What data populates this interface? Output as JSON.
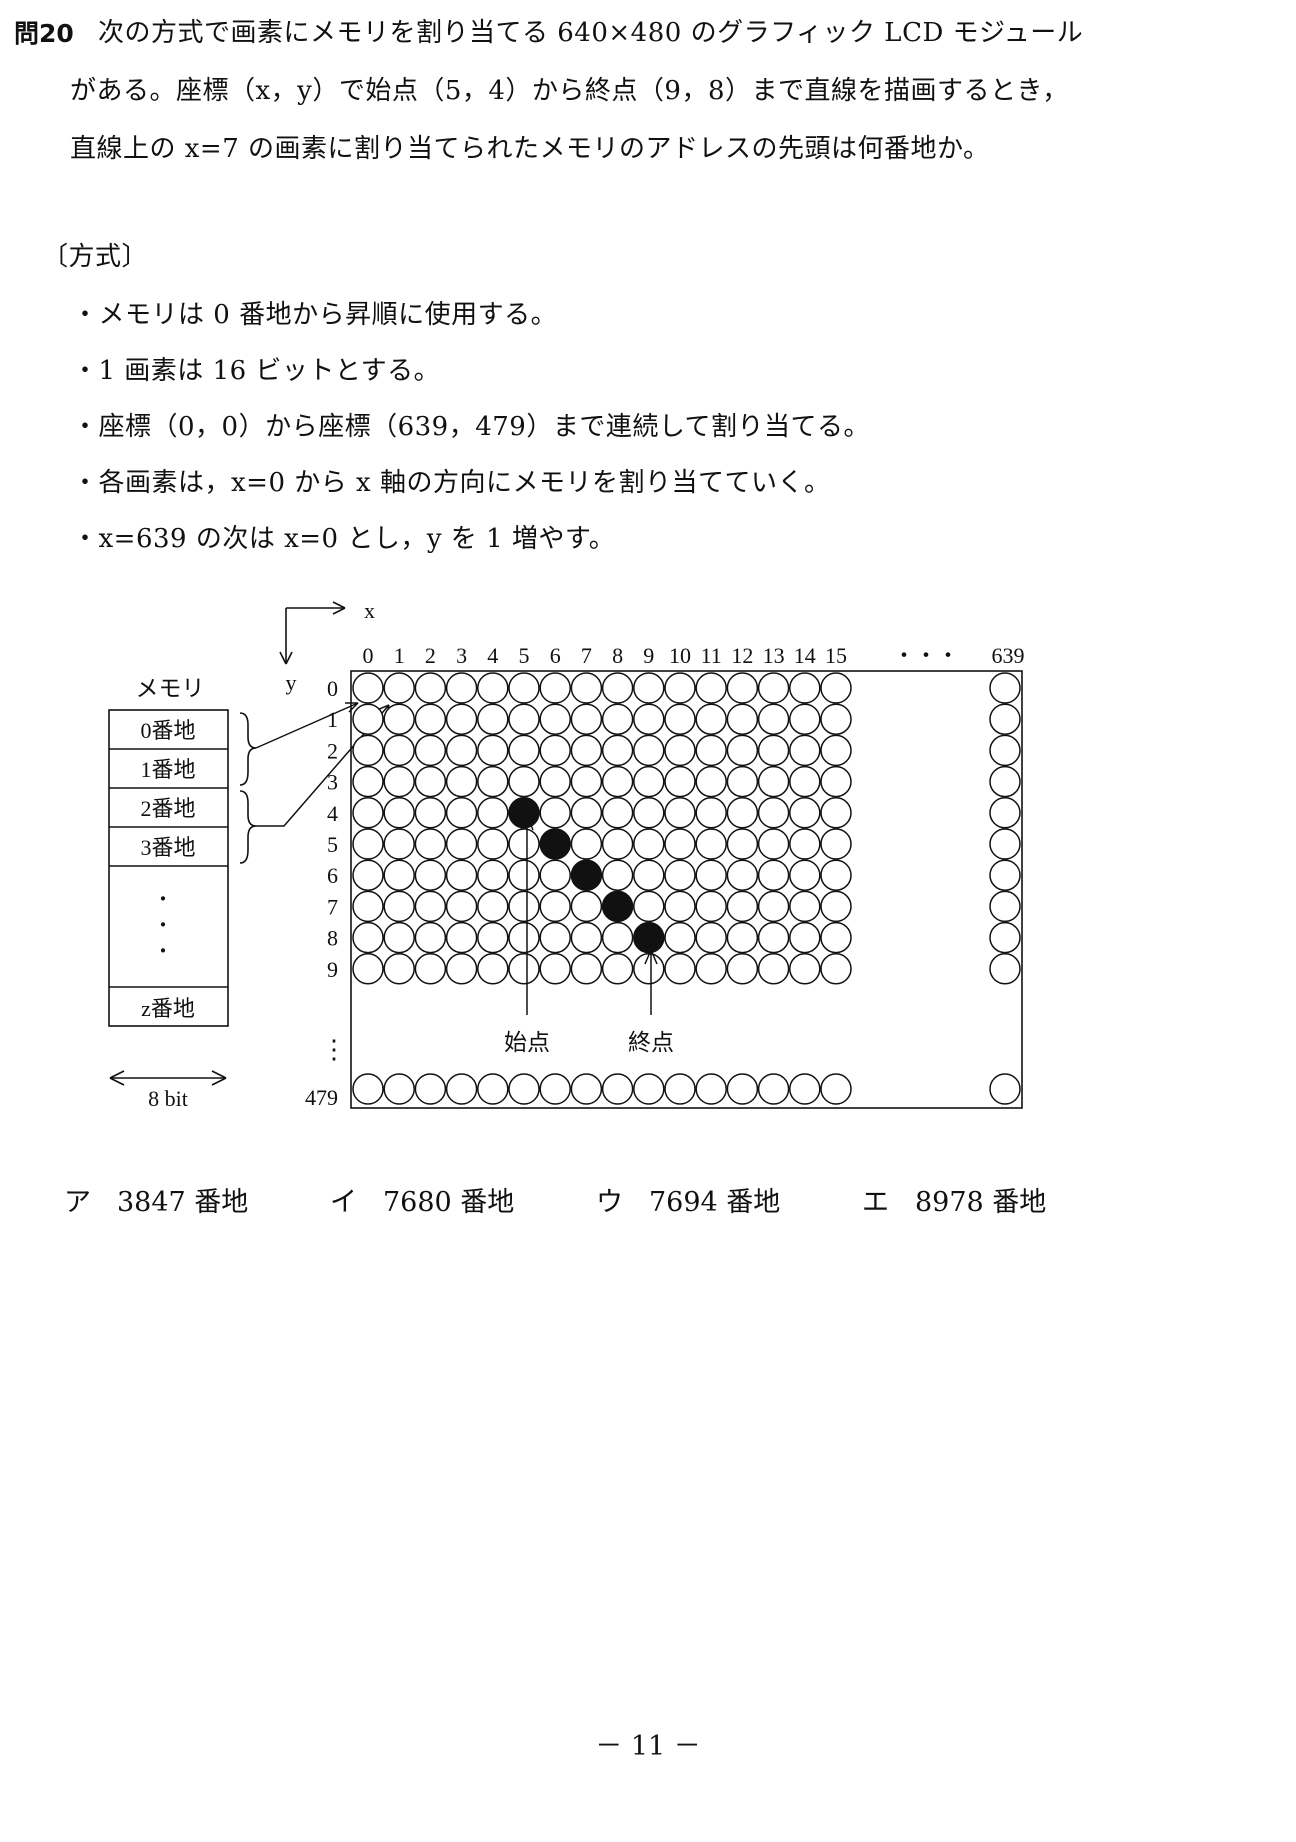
{
  "question": {
    "number": "問20",
    "lines": [
      "次の方式で画素にメモリを割り当てる 640×480 のグラフィック LCD モジュール",
      "がある。座標（x，y）で始点（5，4）から終点（9，8）まで直線を描画するとき，",
      "直線上の x=7 の画素に割り当てられたメモリのアドレスの先頭は何番地か。"
    ]
  },
  "method": {
    "heading": "〔方式〕",
    "bullets": [
      "・メモリは 0 番地から昇順に使用する。",
      "・1 画素は 16 ビットとする。",
      "・座標（0，0）から座標（639，479）まで連続して割り当てる。",
      "・各画素は，x=0 から x 軸の方向にメモリを割り当てていく。",
      "・x=639 の次は x=0 とし，y を 1 増やす。"
    ]
  },
  "diagram": {
    "memory_title": "メモリ",
    "memory_cells": [
      "0番地",
      "1番地",
      "2番地",
      "3番地"
    ],
    "memory_dots": [
      "・",
      "・",
      "・"
    ],
    "memory_last": "z番地",
    "width_label": "8 bit",
    "x_axis": "x",
    "y_axis": "y",
    "x_ticks": [
      "0",
      "1",
      "2",
      "3",
      "4",
      "5",
      "6",
      "7",
      "8",
      "9",
      "10",
      "11",
      "12",
      "13",
      "14",
      "15"
    ],
    "x_ellipsis": "・・・",
    "x_last": "639",
    "y_ticks": [
      "0",
      "1",
      "2",
      "3",
      "4",
      "5",
      "6",
      "7",
      "8",
      "9"
    ],
    "y_ellipsis": "⋮",
    "y_last": "479",
    "start_label": "始点",
    "end_label": "終点",
    "filled_pixels": [
      [
        5,
        4
      ],
      [
        6,
        5
      ],
      [
        7,
        6
      ],
      [
        8,
        7
      ],
      [
        9,
        8
      ]
    ]
  },
  "choices": [
    {
      "key": "ア",
      "text": "3847 番地"
    },
    {
      "key": "イ",
      "text": "7680 番地"
    },
    {
      "key": "ウ",
      "text": "7694 番地"
    },
    {
      "key": "エ",
      "text": "8978 番地"
    }
  ],
  "page_number": "－ 11 －"
}
